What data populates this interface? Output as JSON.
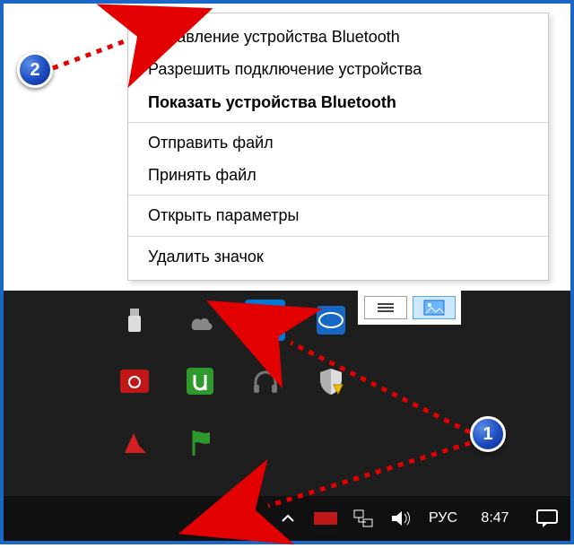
{
  "context_menu": {
    "add_device": "Добавление устройства Bluetooth",
    "allow_connect": "Разрешить подключение устройства",
    "show_devices": "Показать устройства Bluetooth",
    "send_file": "Отправить файл",
    "receive_file": "Принять файл",
    "open_settings": "Открыть параметры",
    "remove_icon": "Удалить значок"
  },
  "tray_icons": {
    "usb": "usb-icon",
    "onedrive": "onedrive-icon",
    "bluetooth": "bluetooth-icon",
    "intel": "intel-icon",
    "camera": "camera-icon",
    "utorrent": "utorrent-icon",
    "headphones": "headphones-icon",
    "security": "security-icon",
    "triangle": "triangle-icon",
    "flag": "flag-icon"
  },
  "taskbar": {
    "chevron": "chevron-up-icon",
    "app": "red-app-icon",
    "network": "network-icon",
    "volume": "volume-icon",
    "language": "РУС",
    "clock": "8:47",
    "action_center": "action-center-icon"
  },
  "steps": {
    "one": "1",
    "two": "2"
  }
}
